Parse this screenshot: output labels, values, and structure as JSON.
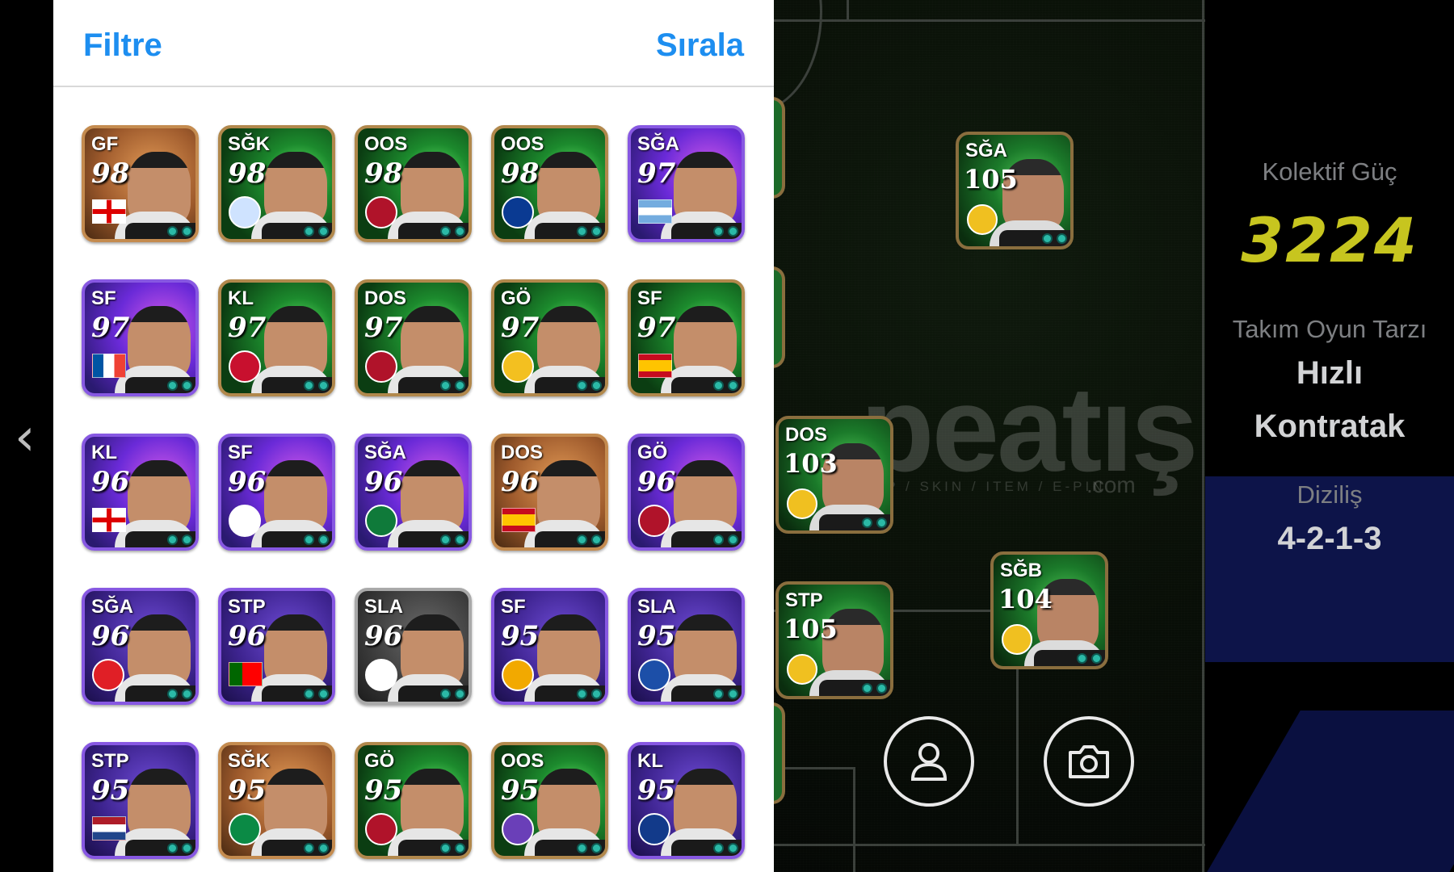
{
  "panel": {
    "filter_label": "Filtre",
    "sort_label": "Sırala"
  },
  "cards": [
    {
      "pos": "GF",
      "rating": "98",
      "style": "pg",
      "mark": "flag",
      "flag": "eng"
    },
    {
      "pos": "SĞK",
      "rating": "98",
      "style": "g",
      "mark": "badge",
      "badge_color": "#cfe3ff"
    },
    {
      "pos": "OOS",
      "rating": "98",
      "style": "g",
      "mark": "badge",
      "badge_color": "#b0132a"
    },
    {
      "pos": "OOS",
      "rating": "98",
      "style": "g",
      "mark": "badge",
      "badge_color": "#0a3a92"
    },
    {
      "pos": "SĞA",
      "rating": "97",
      "style": "p",
      "mark": "flag",
      "flag": "arg"
    },
    {
      "pos": "SF",
      "rating": "97",
      "style": "p",
      "mark": "flag",
      "flag": "fra"
    },
    {
      "pos": "KL",
      "rating": "97",
      "style": "g",
      "mark": "badge",
      "badge_color": "#c8102e"
    },
    {
      "pos": "DOS",
      "rating": "97",
      "style": "g",
      "mark": "badge",
      "badge_color": "#b0132a"
    },
    {
      "pos": "GÖ",
      "rating": "97",
      "style": "g",
      "mark": "badge",
      "badge_color": "#f3c020"
    },
    {
      "pos": "SF",
      "rating": "97",
      "style": "g",
      "mark": "flag",
      "flag": "esp"
    },
    {
      "pos": "KL",
      "rating": "96",
      "style": "p",
      "mark": "flag",
      "flag": "eng"
    },
    {
      "pos": "SF",
      "rating": "96",
      "style": "p",
      "mark": "badge",
      "badge_color": "#ffffff"
    },
    {
      "pos": "SĞA",
      "rating": "96",
      "style": "p",
      "mark": "badge",
      "badge_color": "#0f7a3a"
    },
    {
      "pos": "DOS",
      "rating": "96",
      "style": "pg",
      "mark": "flag",
      "flag": "esp"
    },
    {
      "pos": "GÖ",
      "rating": "96",
      "style": "p",
      "mark": "badge",
      "badge_color": "#b0132a"
    },
    {
      "pos": "SĞA",
      "rating": "96",
      "style": "b",
      "mark": "badge",
      "badge_color": "#e01f26"
    },
    {
      "pos": "STP",
      "rating": "96",
      "style": "b",
      "mark": "flag",
      "flag": "por"
    },
    {
      "pos": "SLA",
      "rating": "96",
      "style": "s",
      "mark": "badge",
      "badge_color": "#ffffff"
    },
    {
      "pos": "SF",
      "rating": "95",
      "style": "b",
      "mark": "badge",
      "badge_color": "#f2a900"
    },
    {
      "pos": "SLA",
      "rating": "95",
      "style": "b",
      "mark": "badge",
      "badge_color": "#1c4fa8"
    },
    {
      "pos": "STP",
      "rating": "95",
      "style": "b",
      "mark": "flag",
      "flag": "ned"
    },
    {
      "pos": "SĞK",
      "rating": "95",
      "style": "pg",
      "mark": "badge",
      "badge_color": "#0b8a45"
    },
    {
      "pos": "GÖ",
      "rating": "95",
      "style": "g",
      "mark": "badge",
      "badge_color": "#b0132a"
    },
    {
      "pos": "OOS",
      "rating": "95",
      "style": "g",
      "mark": "badge",
      "badge_color": "#6a3fb8"
    },
    {
      "pos": "KL",
      "rating": "95",
      "style": "b",
      "mark": "badge",
      "badge_color": "#123a8a"
    }
  ],
  "pitch_cards": [
    {
      "pos": "SĞA",
      "rating": "105"
    },
    {
      "pos": "DOS",
      "rating": "103"
    },
    {
      "pos": "STP",
      "rating": "105"
    },
    {
      "pos": "SĞB",
      "rating": "104"
    }
  ],
  "watermark": {
    "main": "peatış",
    "sub": "HESAP / SKIN / ITEM / E-PIN",
    "com": ".com"
  },
  "stats": {
    "power_label": "Kolektif Güç",
    "power_value": "3224",
    "style_label": "Takım Oyun Tarzı",
    "style_value_1": "Hızlı",
    "style_value_2": "Kontratak",
    "formation_label": "Diziliş",
    "formation_value": "4-2-1-3"
  },
  "icons": [
    "person-icon",
    "camera-icon",
    "chevron-left-icon"
  ]
}
